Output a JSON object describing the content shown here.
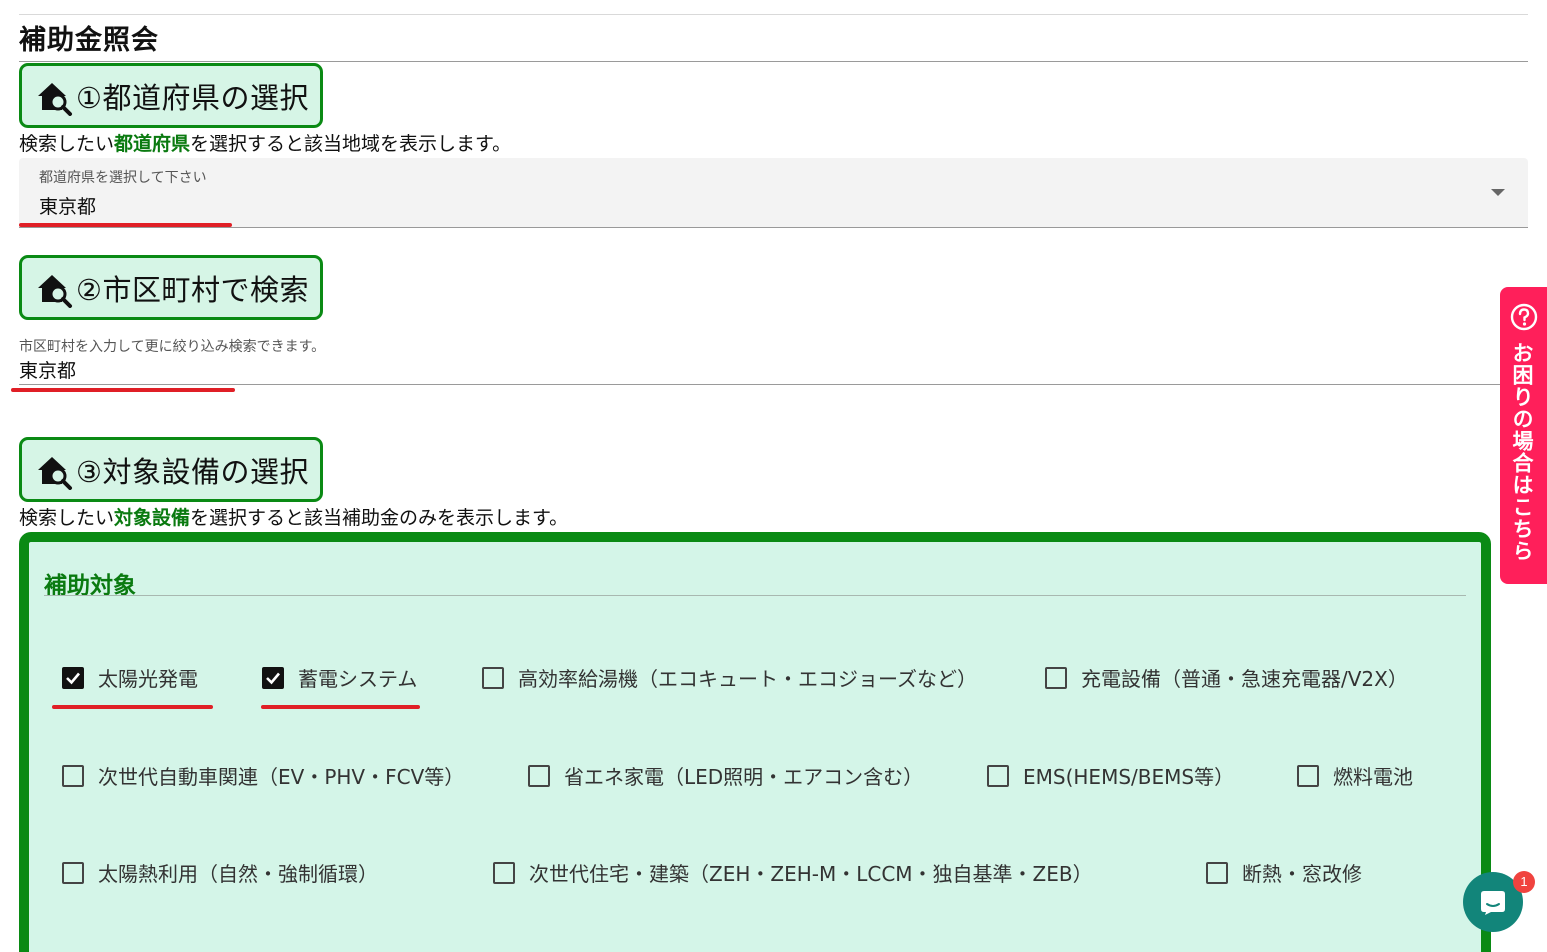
{
  "page": {
    "title": "補助金照会"
  },
  "step1": {
    "heading": "①都道府県の選択",
    "desc_before": "検索したい",
    "desc_highlight": "都道府県",
    "desc_after": "を選択すると該当地域を表示します。",
    "select_label": "都道府県を選択して下さい",
    "select_value": "東京都"
  },
  "step2": {
    "heading": "②市区町村で検索",
    "input_label": "市区町村を入力して更に絞り込み検索できます。",
    "input_value": "東京都"
  },
  "step3": {
    "heading": "③対象設備の選択",
    "desc_before": "検索したい",
    "desc_highlight": "対象設備",
    "desc_after": "を選択すると該当補助金のみを表示します。"
  },
  "panel": {
    "title": "補助対象",
    "options": [
      {
        "label": "太陽光発電",
        "checked": true
      },
      {
        "label": "蓄電システム",
        "checked": true
      },
      {
        "label": "高効率給湯機（エコキュート・エコジョーズなど）",
        "checked": false
      },
      {
        "label": "充電設備（普通・急速充電器/V2X）",
        "checked": false
      },
      {
        "label": "次世代自動車関連（EV・PHV・FCV等）",
        "checked": false
      },
      {
        "label": "省エネ家電（LED照明・エアコン含む）",
        "checked": false
      },
      {
        "label": "EMS(HEMS/BEMS等）",
        "checked": false
      },
      {
        "label": "燃料電池",
        "checked": false
      },
      {
        "label": "太陽熱利用（自然・強制循環）",
        "checked": false
      },
      {
        "label": "次世代住宅・建築（ZEH・ZEH-M・LCCM・独自基準・ZEB）",
        "checked": false
      },
      {
        "label": "断熱・窓改修",
        "checked": false
      }
    ]
  },
  "help_tab": {
    "text": "お困りの場合はこちら",
    "icon": "question-circle-icon"
  },
  "chat": {
    "badge_count": "1",
    "icon": "chat-bubble-icon"
  },
  "colors": {
    "green": "#0a8a14",
    "panel_bg": "#d4f5e8",
    "red": "#e01f26",
    "pink": "#ff1f5a",
    "teal": "#12857a"
  }
}
